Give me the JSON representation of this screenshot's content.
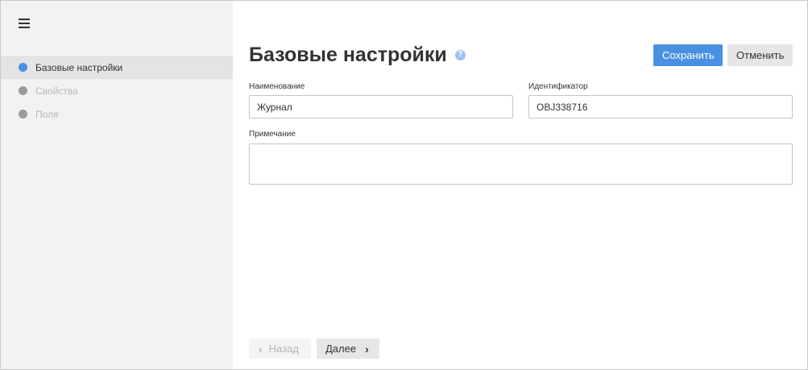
{
  "sidebar": {
    "items": [
      {
        "label": "Базовые настройки",
        "state": "active",
        "color": "#4a90e2"
      },
      {
        "label": "Свойства",
        "state": "inactive",
        "color": "#9b9b9b"
      },
      {
        "label": "Поля",
        "state": "inactive",
        "color": "#9b9b9b"
      }
    ]
  },
  "header": {
    "title": "Базовые настройки",
    "help_glyph": "?",
    "save_label": "Сохранить",
    "cancel_label": "Отменить"
  },
  "form": {
    "name_label": "Наименование",
    "name_value": "Журнал",
    "id_label": "Идентификатор",
    "id_value": "OBJ338716",
    "note_label": "Примечание",
    "note_value": ""
  },
  "footer": {
    "back_label": "Назад",
    "next_label": "Далее"
  },
  "colors": {
    "accent": "#4a90e2",
    "sidebar_bg": "#f2f2f2",
    "active_item_bg": "#e4e4e4"
  }
}
